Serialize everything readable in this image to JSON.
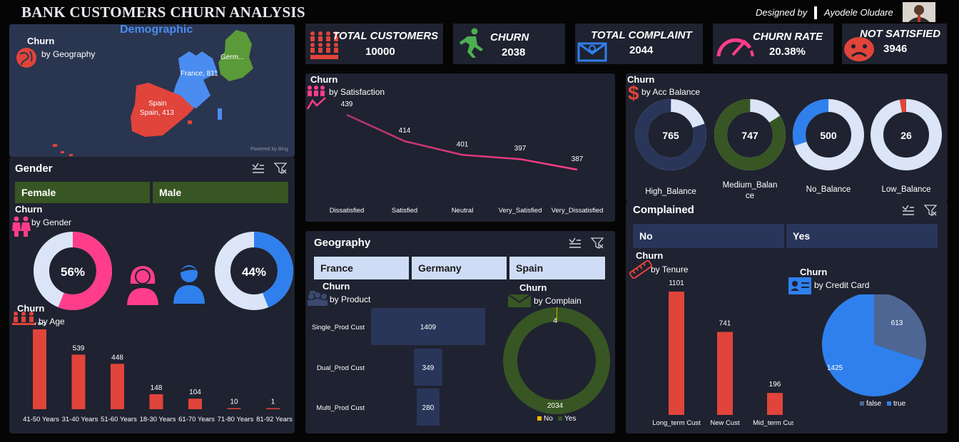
{
  "header": {
    "title": "BANK CUSTOMERS CHURN ANALYSIS",
    "designed_by": "Designed by",
    "designer_name": "Ayodele Oludare"
  },
  "kpis": [
    {
      "label": "TOTAL CUSTOMERS",
      "value": "10000",
      "icon": "people-group-icon",
      "color": "#e0443a"
    },
    {
      "label": "CHURN",
      "value": "2038",
      "icon": "running-person-icon",
      "color": "#4caf50"
    },
    {
      "label": "TOTAL COMPLAINT",
      "value": "2044",
      "icon": "envelope-icon",
      "color": "#2f80ed"
    },
    {
      "label": "CHURN RATE",
      "value": "20.38%",
      "icon": "gauge-icon",
      "color": "#ff3d8b"
    },
    {
      "label": "NOT SATISFIED",
      "value": "3946",
      "icon": "sad-face-icon",
      "color": "#e0443a"
    }
  ],
  "map": {
    "title": "Churn",
    "subtitle": "by Geography",
    "overlay": "Demographic",
    "labels": {
      "france": "France, 811",
      "germany": "Germ...",
      "spain_name": "Spain",
      "spain": "Spain, 413"
    },
    "powered": "Powered by Bing"
  },
  "gender": {
    "header": "Gender",
    "slicers": [
      "Female",
      "Male"
    ],
    "title": "Churn",
    "subtitle": "by Gender",
    "female_pct": "56%",
    "male_pct": "44%",
    "female_frac": 0.56,
    "male_frac": 0.44
  },
  "age": {
    "title": "Churn",
    "subtitle": "by Age",
    "categories": [
      "41-50 Years",
      "31-40 Years",
      "51-60 Years",
      "18-30 Years",
      "61-70 Years",
      "71-80 Years",
      "81-92 Years"
    ],
    "values": [
      788,
      539,
      448,
      148,
      104,
      10,
      1
    ]
  },
  "satisfaction": {
    "title": "Churn",
    "subtitle": "by Satisfaction",
    "categories": [
      "Dissatisfied",
      "Satisfied",
      "Neutral",
      "Very_Satisfied",
      "Very_Dissatisfied"
    ],
    "values": [
      439,
      414,
      401,
      397,
      387
    ]
  },
  "balance": {
    "title": "Churn",
    "subtitle": "by Acc Balance",
    "donuts": [
      {
        "label": "High_Balance",
        "value": "765",
        "frac": 0.8,
        "ring": "#29365a",
        "rest": "#dbe5f7"
      },
      {
        "label": "Medium_Balance",
        "value": "747",
        "frac": 0.84,
        "ring": "#375623",
        "rest": "#dbe5f7"
      },
      {
        "label": "No_Balance",
        "value": "500",
        "frac": 0.3,
        "ring": "#2f80ed",
        "rest": "#dbe5f7"
      },
      {
        "label": "Low_Balance",
        "value": "26",
        "frac": 0.03,
        "ring": "#e0443a",
        "rest": "#dbe5f7"
      }
    ]
  },
  "geography": {
    "header": "Geography",
    "slicers": [
      "France",
      "Germany",
      "Spain"
    ]
  },
  "product": {
    "title": "Churn",
    "subtitle": "by Product",
    "categories": [
      "Single_Prod Cust",
      "Dual_Prod Cust",
      "Multi_Prod Cust"
    ],
    "values": [
      1409,
      349,
      280
    ]
  },
  "complain": {
    "title": "Churn",
    "subtitle": "by Complain",
    "no_value": "4",
    "yes_value": "2034",
    "legend": [
      "No",
      "Yes"
    ],
    "no_color": "#f5b800",
    "yes_color": "#375623"
  },
  "complained": {
    "header": "Complained",
    "slicers": [
      "No",
      "Yes"
    ]
  },
  "tenure": {
    "title": "Churn",
    "subtitle": "by Tenure",
    "categories": [
      "Long_term Cust",
      "New Cust",
      "Mid_term Cust"
    ],
    "values": [
      1101,
      741,
      196
    ]
  },
  "credit": {
    "title": "Churn",
    "subtitle": "by Credit Card",
    "false_value": "613",
    "true_value": "1425",
    "legend": [
      "false",
      "true"
    ],
    "false_num": 613,
    "true_num": 1425
  },
  "chart_data": [
    {
      "type": "bar",
      "title": "Churn by Age",
      "categories": [
        "41-50 Years",
        "31-40 Years",
        "51-60 Years",
        "18-30 Years",
        "61-70 Years",
        "71-80 Years",
        "81-92 Years"
      ],
      "values": [
        788,
        539,
        448,
        148,
        104,
        10,
        1
      ]
    },
    {
      "type": "line",
      "title": "Churn by Satisfaction",
      "categories": [
        "Dissatisfied",
        "Satisfied",
        "Neutral",
        "Very_Satisfied",
        "Very_Dissatisfied"
      ],
      "values": [
        439,
        414,
        401,
        397,
        387
      ]
    },
    {
      "type": "bar",
      "title": "Churn by Product",
      "categories": [
        "Single_Prod Cust",
        "Dual_Prod Cust",
        "Multi_Prod Cust"
      ],
      "values": [
        1409,
        349,
        280
      ]
    },
    {
      "type": "bar",
      "title": "Churn by Tenure",
      "categories": [
        "Long_term Cust",
        "New Cust",
        "Mid_term Cust"
      ],
      "values": [
        1101,
        741,
        196
      ]
    },
    {
      "type": "pie",
      "title": "Churn by Credit Card",
      "categories": [
        "false",
        "true"
      ],
      "values": [
        613,
        1425
      ]
    },
    {
      "type": "pie",
      "title": "Churn by Complain",
      "categories": [
        "No",
        "Yes"
      ],
      "values": [
        4,
        2034
      ]
    },
    {
      "type": "pie",
      "title": "Churn by Gender",
      "categories": [
        "Female",
        "Male"
      ],
      "values": [
        56,
        44
      ]
    },
    {
      "type": "pie",
      "title": "Churn by Acc Balance",
      "categories": [
        "High_Balance",
        "Medium_Balance",
        "No_Balance",
        "Low_Balance"
      ],
      "values": [
        765,
        747,
        500,
        26
      ]
    }
  ]
}
